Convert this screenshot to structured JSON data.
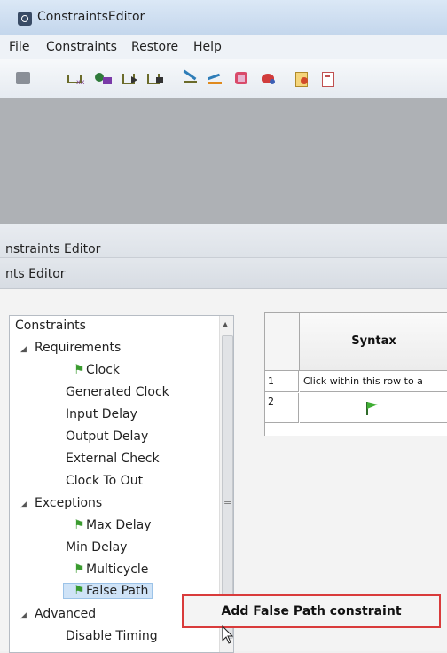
{
  "window": {
    "title": "ConstraintsEditor"
  },
  "menu": [
    "File",
    "Constraints",
    "Restore",
    "Help"
  ],
  "panes": {
    "outer_title": "nstraints Editor",
    "inner_title": "nts Editor"
  },
  "tree": {
    "root": "Constraints",
    "groups": [
      {
        "label": "Requirements",
        "items": [
          {
            "label": "Clock",
            "flagged": true
          },
          {
            "label": "Generated Clock",
            "flagged": false
          },
          {
            "label": "Input Delay",
            "flagged": false
          },
          {
            "label": "Output Delay",
            "flagged": false
          },
          {
            "label": "External Check",
            "flagged": false
          },
          {
            "label": "Clock To Out",
            "flagged": false
          }
        ]
      },
      {
        "label": "Exceptions",
        "items": [
          {
            "label": "Max Delay",
            "flagged": true
          },
          {
            "label": "Min Delay",
            "flagged": false
          },
          {
            "label": "Multicycle",
            "flagged": true
          },
          {
            "label": "False Path",
            "flagged": true,
            "selected": true
          }
        ]
      },
      {
        "label": "Advanced",
        "items": [
          {
            "label": "Disable Timing",
            "flagged": false
          }
        ]
      }
    ]
  },
  "grid": {
    "column_header": "Syntax",
    "rows": [
      {
        "num": "1",
        "text": "Click within this row to a"
      },
      {
        "num": "2",
        "text": ""
      }
    ]
  },
  "context_menu": {
    "item": "Add False Path constraint"
  },
  "colors": {
    "highlight_border": "#d93b3b",
    "selection": "#cfe3f7",
    "flag": "#3a9b2f"
  }
}
